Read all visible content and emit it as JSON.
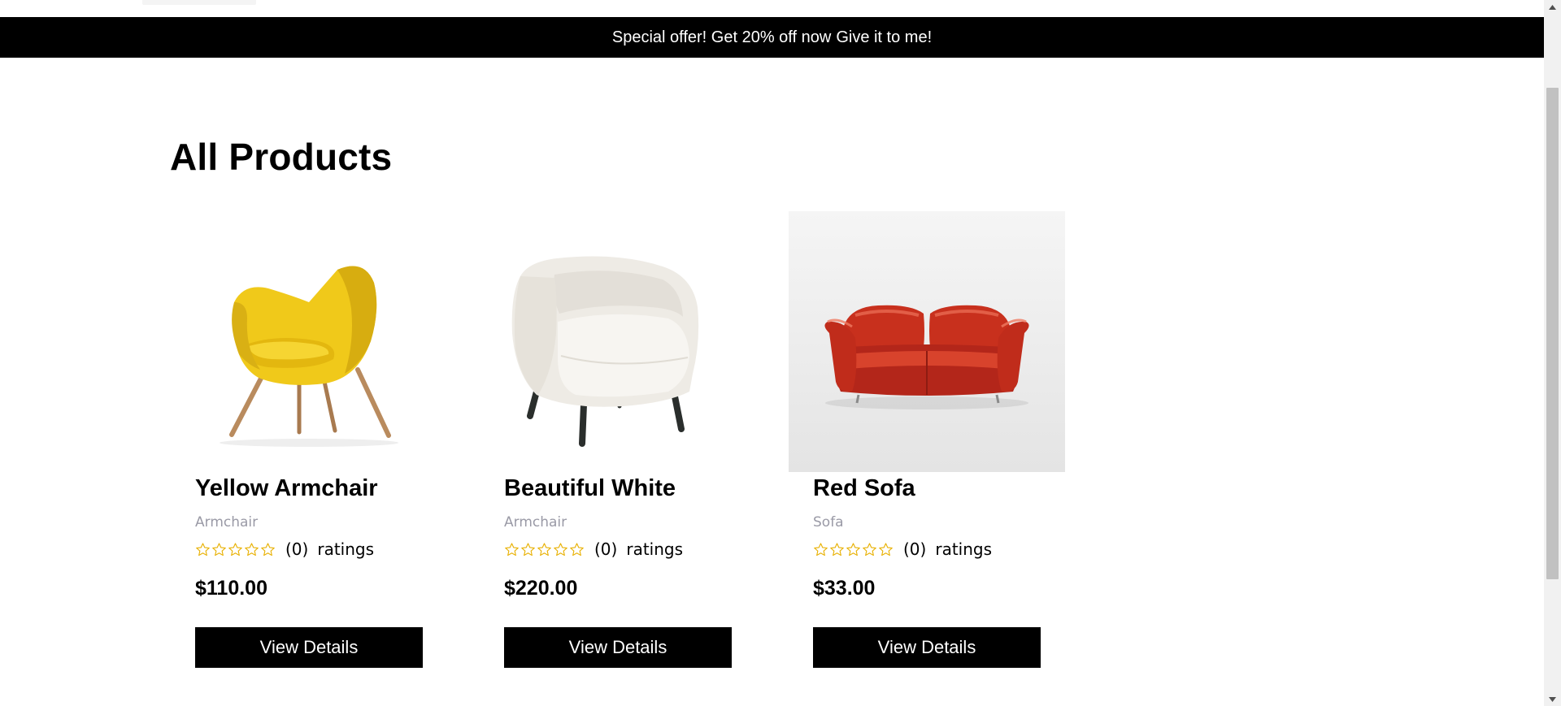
{
  "promo": {
    "text": "Special offer! Get 20% off now",
    "link": "Give it to me!"
  },
  "main": {
    "title": "All Products"
  },
  "products": [
    {
      "name": "Yellow Armchair",
      "category": "Armchair",
      "rating_count": "(0)",
      "ratings_label": "ratings",
      "stars_filled": 0,
      "stars_total": 5,
      "price": "$110.00",
      "button_label": "View Details"
    },
    {
      "name": "Beautiful White",
      "category": "Armchair",
      "rating_count": "(0)",
      "ratings_label": "ratings",
      "stars_filled": 0,
      "stars_total": 5,
      "price": "$220.00",
      "button_label": "View Details"
    },
    {
      "name": "Red Sofa",
      "category": "Sofa",
      "rating_count": "(0)",
      "ratings_label": "ratings",
      "stars_filled": 0,
      "stars_total": 5,
      "price": "$33.00",
      "button_label": "View Details"
    }
  ],
  "colors": {
    "promo_bg": "#000000",
    "star_outline": "#e8b000",
    "category_text": "#9a9aa6",
    "button_bg": "#000000"
  },
  "icons": {
    "star": "star-outline-icon",
    "scroll_up": "scroll-up-arrow-icon",
    "scroll_down": "scroll-down-arrow-icon"
  }
}
